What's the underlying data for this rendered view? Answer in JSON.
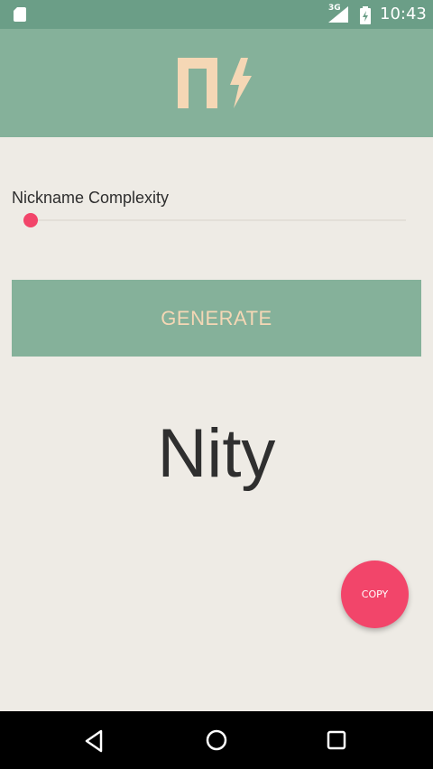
{
  "status_bar": {
    "network_label": "3G",
    "time": "10:43",
    "icons": [
      "sd-card-icon",
      "signal-icon",
      "battery-icon"
    ]
  },
  "app_bar": {
    "logo_icon": "app-logo-icon",
    "background_color": "#85B19A",
    "logo_color": "#F5D7B5"
  },
  "settings": {
    "complexity_label": "Nickname Complexity",
    "complexity_value": 0,
    "accent_color": "#F2456A"
  },
  "actions": {
    "generate_label": "GENERATE",
    "copy_label": "COPY"
  },
  "result": {
    "nickname": "Nity"
  },
  "nav_bar": {
    "icons": [
      "back-icon",
      "home-icon",
      "recents-icon"
    ]
  }
}
